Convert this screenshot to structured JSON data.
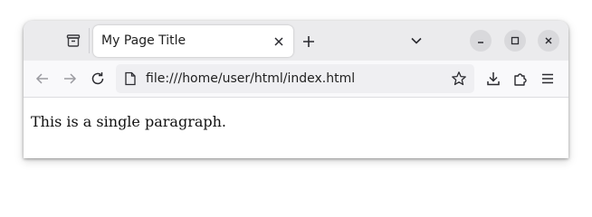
{
  "browser": {
    "tab": {
      "title": "My Page Title"
    },
    "address_bar": {
      "url": "file:///home/user/html/index.html"
    },
    "icons": {
      "tab_overview": "tab-overview-icon",
      "tab_close": "close-icon",
      "new_tab": "plus-icon",
      "tab_list": "chevron-down-icon",
      "minimize": "minimize-icon",
      "maximize": "maximize-icon",
      "window_close": "close-icon",
      "back": "arrow-left-icon",
      "forward": "arrow-right-icon",
      "reload": "reload-icon",
      "page": "page-icon",
      "bookmark": "star-icon",
      "downloads": "download-icon",
      "extensions": "puzzle-icon",
      "menu": "hamburger-menu-icon"
    }
  },
  "page": {
    "paragraph": "This is a single paragraph."
  }
}
